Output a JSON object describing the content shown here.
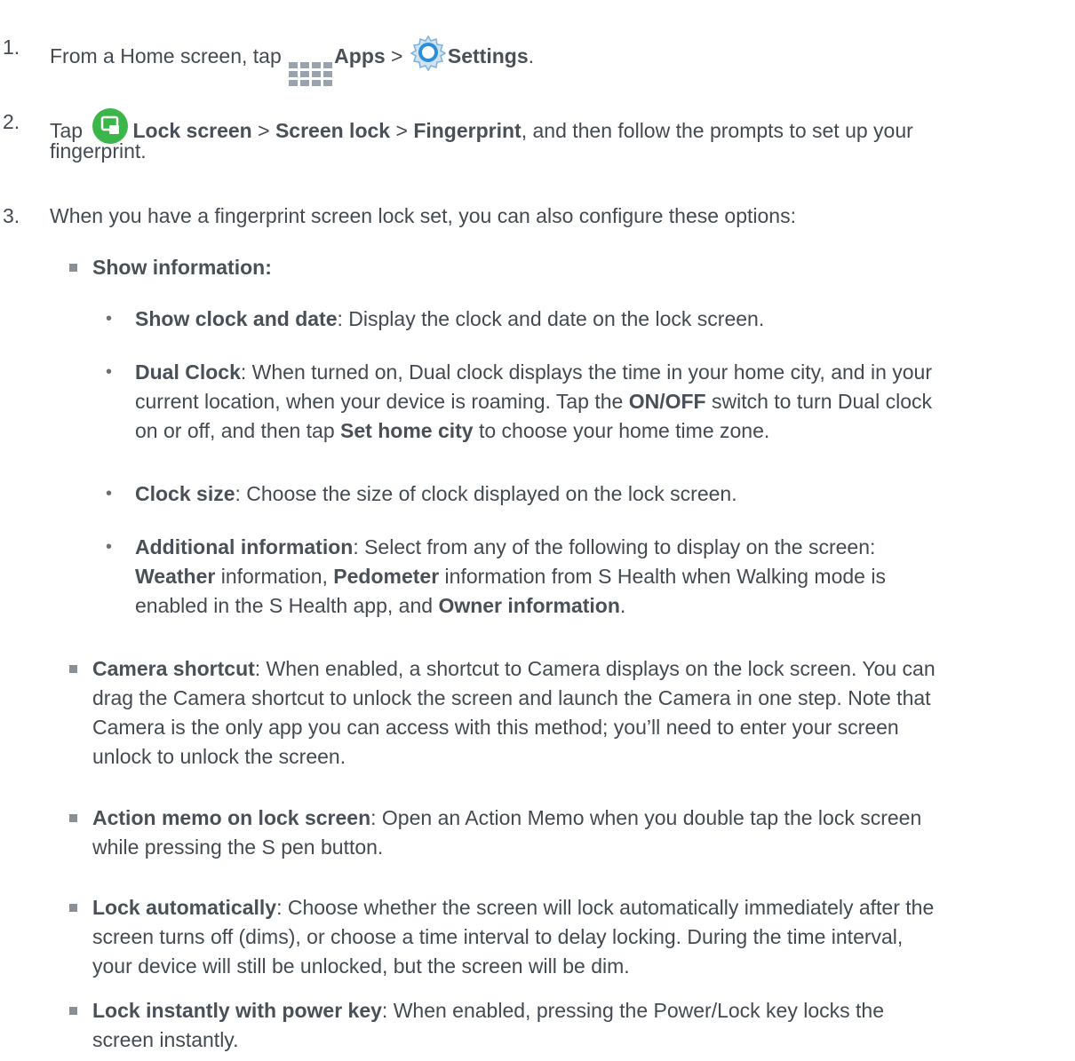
{
  "step1": {
    "num": "1.",
    "t1": "From a Home screen, tap",
    "apps": "Apps",
    "sep": ">",
    "settings": "Settings",
    "end": "."
  },
  "step2": {
    "num": "2.",
    "t1": "Tap",
    "lock_screen": "Lock screen",
    "sep1": ">",
    "screen_lock": "Screen lock",
    "sep2": ">",
    "fingerprint": "Fingerprint",
    "t2": ", and then follow the prompts to set up your",
    "t3": "fingerprint."
  },
  "step3": {
    "num": "3.",
    "text": "When you have a fingerprint screen lock set, you can also configure these options:"
  },
  "show_info": {
    "label": "Show information:"
  },
  "show_clock": {
    "label": "Show clock and date",
    "text": ": Display the clock and date on the lock screen."
  },
  "dual_clock": {
    "label": "Dual Clock",
    "t1": ": When turned on, Dual clock displays the time in your home city, and in your",
    "t2": "current location, when your device is roaming. Tap the ",
    "onoff": "ON/OFF",
    "t3": " switch to turn Dual clock",
    "t4": "on or off, and then tap ",
    "set_home": "Set home city",
    "t5": " to choose your home time zone."
  },
  "clock_size": {
    "label": "Clock size",
    "text": ": Choose the size of clock displayed on the lock screen."
  },
  "additional": {
    "label": "Additional information",
    "t1": ": Select from any of the following to display on the screen:",
    "weather": "Weather",
    "t2": " information, ",
    "pedometer": "Pedometer",
    "t3": " information from S Health when Walking mode is",
    "t4": "enabled in the S Health app, and ",
    "owner": "Owner information",
    "t5": "."
  },
  "camera": {
    "label": "Camera shortcut",
    "t1": ": When enabled, a shortcut to Camera displays on the lock screen. You can",
    "t2": "drag the Camera shortcut to unlock the screen and launch the Camera in one step. Note that",
    "t3": "Camera is the only app you can access with this method; you’ll need to enter your screen",
    "t4": "unlock to unlock the screen."
  },
  "action_memo": {
    "label": "Action memo on lock screen",
    "t1": ": Open an Action Memo when you double tap the lock screen",
    "t2": "while pressing the S pen button."
  },
  "lock_auto": {
    "label": "Lock automatically",
    "t1": ": Choose whether the screen will lock automatically immediately after the",
    "t2": "screen turns off (dims), or choose a time interval to delay locking. During the time interval,",
    "t3": "your device will still be unlocked, but the screen will be dim."
  },
  "lock_power": {
    "label": "Lock instantly with power key",
    "t1": ": When enabled, pressing the Power/Lock key locks the",
    "t2": "screen instantly."
  },
  "icons": {
    "apps": "apps-grid-icon",
    "settings": "settings-gear-icon",
    "lock_screen": "lock-screen-icon"
  }
}
